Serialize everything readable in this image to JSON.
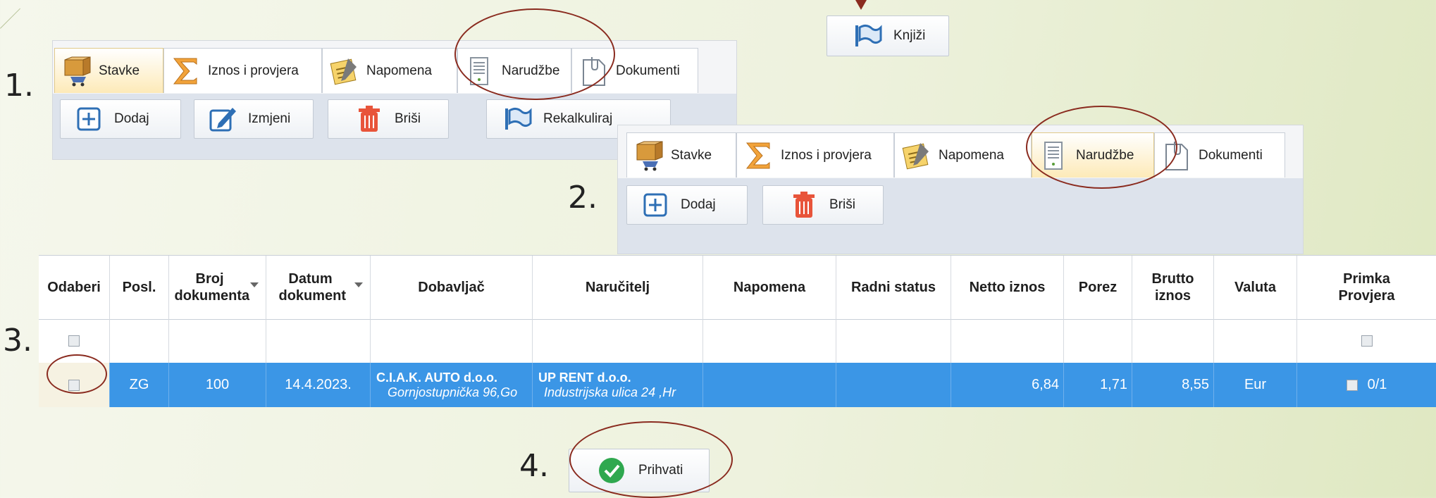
{
  "steps": [
    "1.",
    "2.",
    "3.",
    "4."
  ],
  "top_button": {
    "label": "Knjiži",
    "icon": "flag-icon"
  },
  "panel1": {
    "tabs": [
      {
        "label": "Stavke",
        "icon": "cart-box-icon",
        "active": true
      },
      {
        "label": "Iznos i provjera",
        "icon": "sigma-icon",
        "active": false
      },
      {
        "label": "Napomena",
        "icon": "note-icon",
        "active": false
      },
      {
        "label": "Narudžbe",
        "icon": "document-list-icon",
        "active": false
      },
      {
        "label": "Dokumenti",
        "icon": "clip-document-icon",
        "active": false
      }
    ],
    "buttons": [
      {
        "label": "Dodaj",
        "icon": "plus-icon"
      },
      {
        "label": "Izmjeni",
        "icon": "edit-pencil-icon"
      },
      {
        "label": "Briši",
        "icon": "trash-icon"
      },
      {
        "label": "Rekalkuliraj",
        "icon": "flag-icon"
      }
    ]
  },
  "panel2": {
    "tabs": [
      {
        "label": "Stavke",
        "icon": "cart-box-icon",
        "active": false
      },
      {
        "label": "Iznos i provjera",
        "icon": "sigma-icon",
        "active": false
      },
      {
        "label": "Napomena",
        "icon": "note-icon",
        "active": false
      },
      {
        "label": "Narudžbe",
        "icon": "document-list-icon",
        "active": true
      },
      {
        "label": "Dokumenti",
        "icon": "clip-document-icon",
        "active": false
      }
    ],
    "buttons": [
      {
        "label": "Dodaj",
        "icon": "plus-icon"
      },
      {
        "label": "Briši",
        "icon": "trash-icon"
      }
    ]
  },
  "grid": {
    "columns": [
      {
        "label": "Odaberi",
        "sortable": false
      },
      {
        "label": "Posl.",
        "sortable": false
      },
      {
        "label": "Broj dokumenta",
        "sortable": true
      },
      {
        "label": "Datum dokument",
        "sortable": true
      },
      {
        "label": "Dobavljač",
        "sortable": false
      },
      {
        "label": "Naručitelj",
        "sortable": false
      },
      {
        "label": "Napomena",
        "sortable": false
      },
      {
        "label": "Radni status",
        "sortable": false
      },
      {
        "label": "Netto iznos",
        "sortable": false
      },
      {
        "label": "Porez",
        "sortable": false
      },
      {
        "label": "Brutto iznos",
        "sortable": false
      },
      {
        "label": "Valuta",
        "sortable": false
      },
      {
        "label": "Primka Provjera",
        "sortable": false
      }
    ],
    "row": {
      "posl": "ZG",
      "broj": "100",
      "datum": "14.4.2023.",
      "dobavljac_name": "C.I.A.K. AUTO d.o.o.",
      "dobavljac_address": "Gornjostupnička 96,Go",
      "narucitelj_name": "UP RENT d.o.o.",
      "narucitelj_address": "Industrijska ulica 24 ,Hr",
      "napomena": "",
      "radni_status": "",
      "netto": "6,84",
      "porez": "1,71",
      "brutto": "8,55",
      "valuta": "Eur",
      "provjera": "0/1"
    }
  },
  "accept_button": {
    "label": "Prihvati",
    "icon": "checkmark-circle-icon"
  },
  "colors": {
    "selection": "#3b96e6",
    "highlight_ellipse": "#8a2b1f",
    "active_tab": "#fdeab8"
  }
}
